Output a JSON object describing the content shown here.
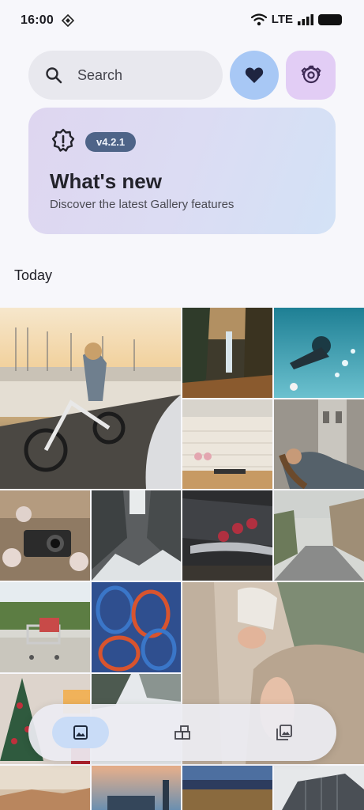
{
  "status_bar": {
    "time": "16:00",
    "network": "LTE",
    "icons": [
      "nfc-icon",
      "wifi-icon",
      "signal-icon",
      "battery-icon"
    ]
  },
  "search": {
    "placeholder": "Search",
    "value": ""
  },
  "header_buttons": {
    "favorites_icon": "heart-icon",
    "settings_icon": "gear-icon"
  },
  "whats_new": {
    "version": "v4.2.1",
    "title": "What's new",
    "subtitle": "Discover the latest Gallery features",
    "icon": "alert-badge-icon"
  },
  "section_title": "Today",
  "photos": [
    "woman-riding-ebike",
    "waterfall",
    "underwater-diver",
    "white-kitchen",
    "woman-lying-down",
    "cotton-and-camera",
    "snowy-canyon",
    "classic-car-taillights",
    "village-road",
    "shopping-cart",
    "tennis-rackets",
    "sleeping-baby",
    "christmas-tree",
    "winter-forest",
    "coastal-town",
    "city-sunset",
    "city-at-dusk",
    "glass-building"
  ],
  "bottom_nav": {
    "items": [
      {
        "icon": "photos-icon",
        "active": true
      },
      {
        "icon": "albums-icon",
        "active": false
      },
      {
        "icon": "library-icon",
        "active": false
      }
    ]
  },
  "colors": {
    "background": "#f7f7fb",
    "search_bg": "#e8e8ee",
    "favorites_bg": "#a8c8f5",
    "settings_bg": "#e2cdf5",
    "badge_bg": "#4e6488",
    "nav_active": "#c9dcf7"
  }
}
